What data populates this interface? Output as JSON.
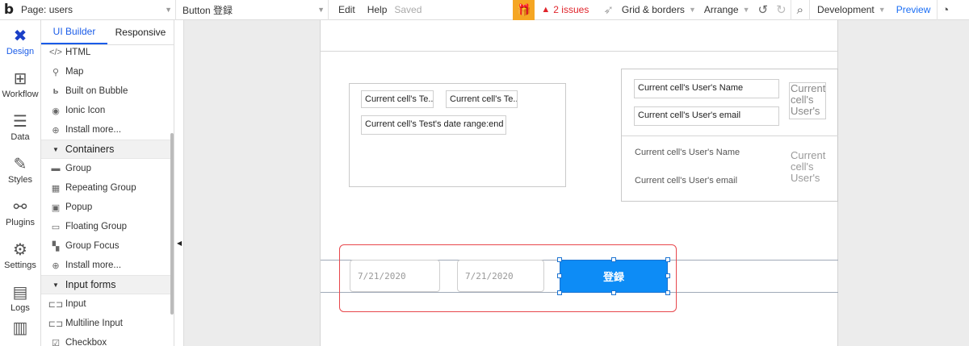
{
  "topbar": {
    "logo": "b",
    "page_select": "Page: users",
    "element_select": "Button 登録",
    "edit": "Edit",
    "help": "Help",
    "saved": "Saved",
    "issues": "2 issues",
    "grid_borders": "Grid & borders",
    "arrange": "Arrange",
    "environment": "Development",
    "preview": "Preview"
  },
  "rail": [
    {
      "label": "Design",
      "icon": "design-icon"
    },
    {
      "label": "Workflow",
      "icon": "workflow-icon"
    },
    {
      "label": "Data",
      "icon": "database-icon"
    },
    {
      "label": "Styles",
      "icon": "brush-icon"
    },
    {
      "label": "Plugins",
      "icon": "plug-icon"
    },
    {
      "label": "Settings",
      "icon": "gear-icon"
    },
    {
      "label": "Logs",
      "icon": "document-icon"
    }
  ],
  "palette": {
    "tabs": [
      "UI Builder",
      "Responsive"
    ],
    "items_top": [
      {
        "label": "HTML",
        "icon": "code-icon"
      },
      {
        "label": "Map",
        "icon": "map-pin-icon"
      },
      {
        "label": "Built on Bubble",
        "icon": "bubble-logo-icon"
      },
      {
        "label": "Ionic Icon",
        "icon": "ionic-icon"
      },
      {
        "label": "Install more...",
        "icon": "plus-circle-icon"
      }
    ],
    "containers_header": "Containers",
    "containers": [
      {
        "label": "Group",
        "icon": "folder-icon"
      },
      {
        "label": "Repeating Group",
        "icon": "repeating-group-icon"
      },
      {
        "label": "Popup",
        "icon": "popup-icon"
      },
      {
        "label": "Floating Group",
        "icon": "floating-group-icon"
      },
      {
        "label": "Group Focus",
        "icon": "group-focus-icon"
      },
      {
        "label": "Install more...",
        "icon": "plus-circle-icon"
      }
    ],
    "inputs_header": "Input forms",
    "inputs": [
      {
        "label": "Input",
        "icon": "input-icon"
      },
      {
        "label": "Multiline Input",
        "icon": "multiline-input-icon"
      },
      {
        "label": "Checkbox",
        "icon": "checkbox-icon"
      }
    ]
  },
  "canvas": {
    "rg1_text1": "Current cell's Te...",
    "rg1_text2": "Current cell's Te...",
    "rg1_text3": "Current cell's Test's date range:end",
    "rg2_name_boxed": "Current cell's User's Name",
    "rg2_email_boxed": "Current cell's User's email",
    "rg2_img_boxed": "Current cell's User's",
    "rg2_name_plain": "Current cell's User's Name",
    "rg2_email_plain": "Current cell's User's email",
    "rg2_img_plain": "Current cell's User's",
    "date1": "7/21/2020",
    "date2": "7/21/2020",
    "button": "登録"
  }
}
